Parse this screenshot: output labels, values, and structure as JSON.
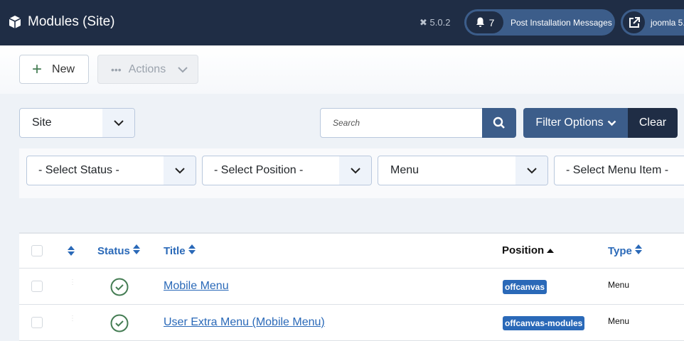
{
  "header": {
    "title": "Modules (Site)",
    "version": "5.0.2",
    "messages_count": "7",
    "messages_label": "Post Installation Messages",
    "site_link": "joomla 5."
  },
  "toolbar": {
    "new_label": "New",
    "actions_label": "Actions"
  },
  "filters": {
    "client": "Site",
    "search_placeholder": "Search",
    "filter_options": "Filter Options",
    "clear": "Clear",
    "status": "- Select Status -",
    "position": "- Select Position -",
    "module_type": "Menu",
    "menu_item": "- Select Menu Item -"
  },
  "table": {
    "headers": {
      "status": "Status",
      "title": "Title",
      "position": "Position",
      "type": "Type"
    },
    "rows": [
      {
        "title": "Mobile Menu",
        "position": "offcanvas",
        "type": "Menu"
      },
      {
        "title": "User Extra Menu (Mobile Menu)",
        "position": "offcanvas-modules",
        "type": "Menu"
      }
    ]
  },
  "colors": {
    "header_bg": "#1f2d45",
    "primary": "#3c5d8a",
    "link": "#2a69b8",
    "success": "#457d54"
  }
}
